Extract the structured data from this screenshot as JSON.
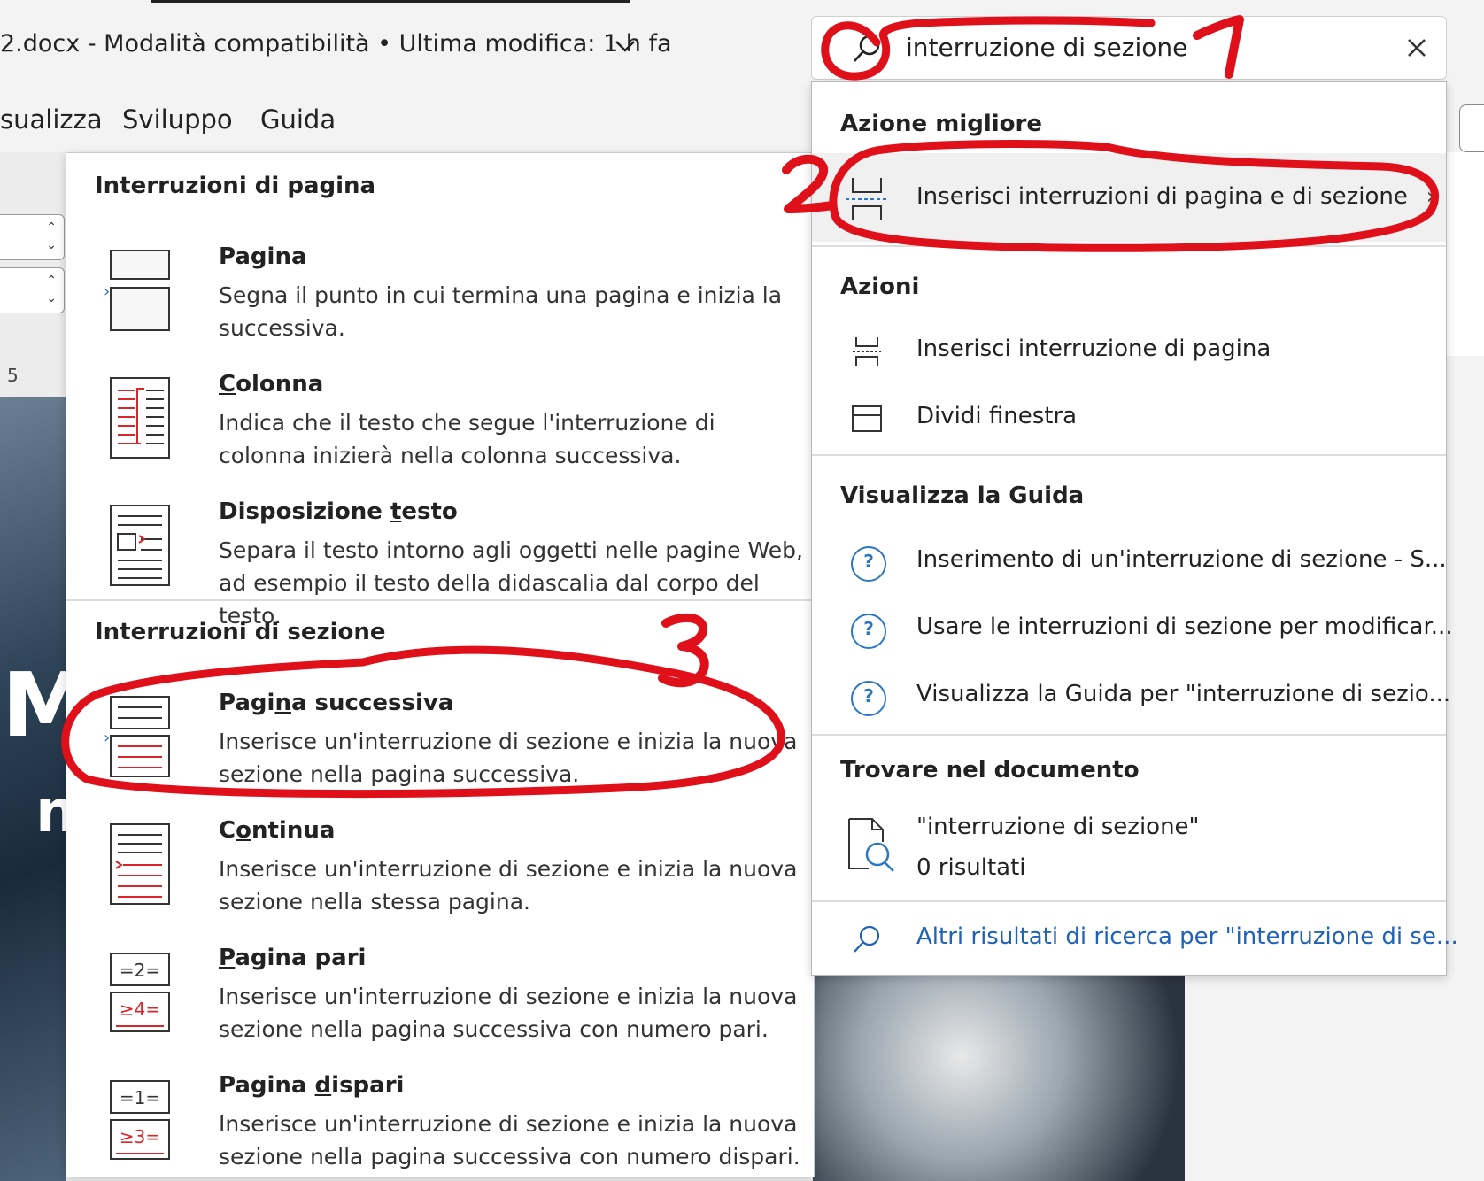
{
  "titlebar": {
    "doc_title": "2.docx  -  Modalità compatibilità  •  Ultima modifica: 1 h fa"
  },
  "ribbon": {
    "tabs": [
      "sualizza",
      "Sviluppo",
      "Guida"
    ]
  },
  "left_sidebar": {
    "ruler_number": "5",
    "doc_letters": [
      "M",
      "n"
    ]
  },
  "breaks_panel": {
    "page_breaks_title": "Interruzioni di pagina",
    "section_breaks_title": "Interruzioni di sezione",
    "page_breaks": [
      {
        "title": "Pagina",
        "desc": "Segna il punto in cui termina una pagina e inizia la successiva.",
        "icon": "page-break-icon"
      },
      {
        "title": "Colonna",
        "desc": "Indica che il testo che segue l'interruzione di colonna inizierà nella colonna successiva.",
        "icon": "column-break-icon"
      },
      {
        "title": "Disposizione testo",
        "desc": "Separa il testo intorno agli oggetti nelle pagine Web, ad esempio il testo della didascalia dal corpo del testo.",
        "icon": "text-wrapping-icon"
      }
    ],
    "section_breaks": [
      {
        "title": "Pagina successiva",
        "desc": "Inserisce un'interruzione di sezione e inizia la nuova sezione nella pagina successiva.",
        "icon": "next-page-icon"
      },
      {
        "title": "Continua",
        "desc": "Inserisce un'interruzione di sezione e inizia la nuova sezione nella stessa pagina.",
        "icon": "continuous-icon"
      },
      {
        "title": "Pagina pari",
        "desc": "Inserisce un'interruzione di sezione e inizia la nuova sezione nella pagina successiva con numero pari.",
        "icon": "even-page-icon"
      },
      {
        "title": "Pagina dispari",
        "desc": "Inserisce un'interruzione di sezione e inizia la nuova sezione nella pagina successiva con numero dispari.",
        "icon": "odd-page-icon"
      }
    ]
  },
  "search": {
    "query": "interruzione di sezione"
  },
  "results": {
    "best_action_title": "Azione migliore",
    "best_action_label": "Inserisci interruzioni di pagina e di sezione",
    "actions_title": "Azioni",
    "actions": [
      {
        "label": "Inserisci interruzione di pagina",
        "icon": "page-break-icon"
      },
      {
        "label": "Dividi finestra",
        "icon": "split-window-icon"
      }
    ],
    "help_title": "Visualizza la Guida",
    "help_items": [
      "Inserimento di un'interruzione di sezione - S...",
      "Usare le interruzioni di sezione per modificar...",
      "Visualizza la Guida per \"interruzione di sezio..."
    ],
    "find_title": "Trovare nel documento",
    "find_query": "\"interruzione di sezione\"",
    "find_count": "0 risultati",
    "more_results": "Altri risultati di ricerca per \"interruzione di se..."
  },
  "annotations": {
    "numbers": [
      "1",
      "2",
      "3"
    ],
    "color": "#e0101a"
  },
  "colors": {
    "accent_red": "#d9262b",
    "help_blue": "#2b77c5",
    "link_blue": "#1f62b7"
  }
}
